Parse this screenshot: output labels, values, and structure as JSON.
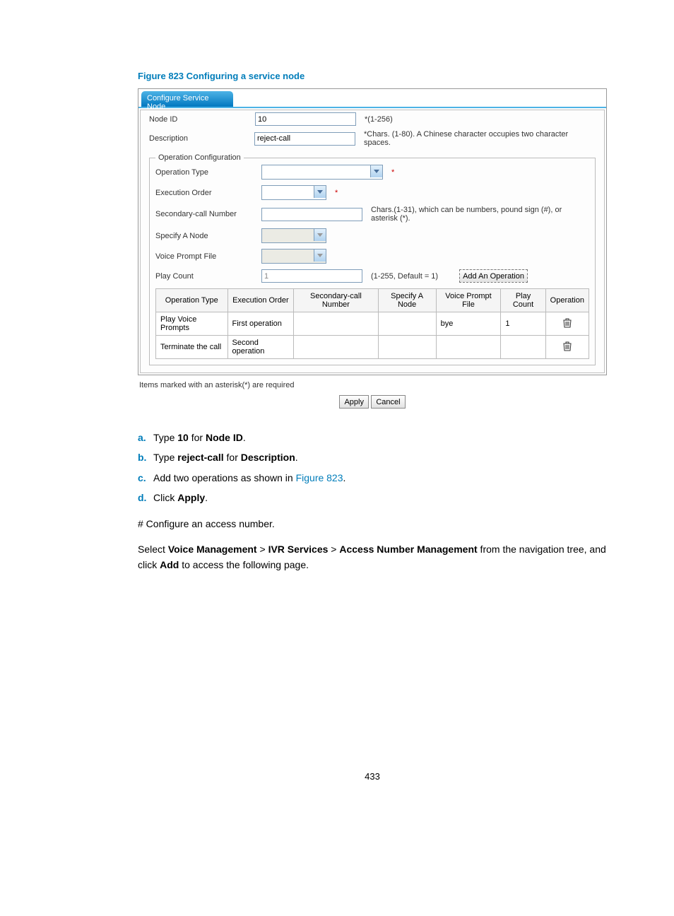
{
  "figure_caption": "Figure 823 Configuring a service node",
  "screenshot": {
    "tab_title": "Configure Service Node",
    "node_id_label": "Node ID",
    "node_id_value": "10",
    "node_id_hint": "*(1-256)",
    "description_label": "Description",
    "description_value": "reject-call",
    "description_hint": "*Chars. (1-80). A Chinese character occupies two character spaces.",
    "opconf_legend": "Operation Configuration",
    "operation_type_label": "Operation Type",
    "execution_order_label": "Execution Order",
    "secondary_call_label": "Secondary-call Number",
    "secondary_call_hint": "Chars.(1-31), which can be numbers, pound sign (#), or asterisk (*).",
    "specify_node_label": "Specify A Node",
    "voice_prompt_label": "Voice Prompt File",
    "play_count_label": "Play Count",
    "play_count_value": "1",
    "play_count_hint": "(1-255, Default = 1)",
    "add_op_button": "Add An Operation",
    "table": {
      "headers": [
        "Operation Type",
        "Execution Order",
        "Secondary-call Number",
        "Specify A Node",
        "Voice Prompt File",
        "Play Count",
        "Operation"
      ],
      "rows": [
        {
          "op_type": "Play Voice Prompts",
          "exec_order": "First operation",
          "sec_num": "",
          "spec_node": "",
          "vpf": "bye",
          "play_count": "1"
        },
        {
          "op_type": "Terminate the call",
          "exec_order": "Second operation",
          "sec_num": "",
          "spec_node": "",
          "vpf": "",
          "play_count": ""
        }
      ]
    },
    "required_note": "Items marked with an asterisk(*) are required",
    "apply_btn": "Apply",
    "cancel_btn": "Cancel"
  },
  "instructions": {
    "a_prefix": "a.",
    "a_text_1": "Type ",
    "a_bold_1": "10",
    "a_text_2": " for ",
    "a_bold_2": "Node ID",
    "a_text_3": ".",
    "b_prefix": "b.",
    "b_text_1": "Type ",
    "b_bold_1": "reject-call",
    "b_text_2": " for ",
    "b_bold_2": "Description",
    "b_text_3": ".",
    "c_prefix": "c.",
    "c_text_1": "Add two operations as shown in ",
    "c_link": "Figure 823",
    "c_text_2": ".",
    "d_prefix": "d.",
    "d_text_1": "Click ",
    "d_bold_1": "Apply",
    "d_text_2": ".",
    "hash_line": "# Configure an access number.",
    "nav_1": "Select ",
    "nav_b1": "Voice Management",
    "nav_gt1": " > ",
    "nav_b2": "IVR Services",
    "nav_gt2": " > ",
    "nav_b3": "Access Number Management",
    "nav_2": " from the navigation tree, and click ",
    "nav_b4": "Add",
    "nav_3": " to access the following page."
  },
  "page_number": "433"
}
